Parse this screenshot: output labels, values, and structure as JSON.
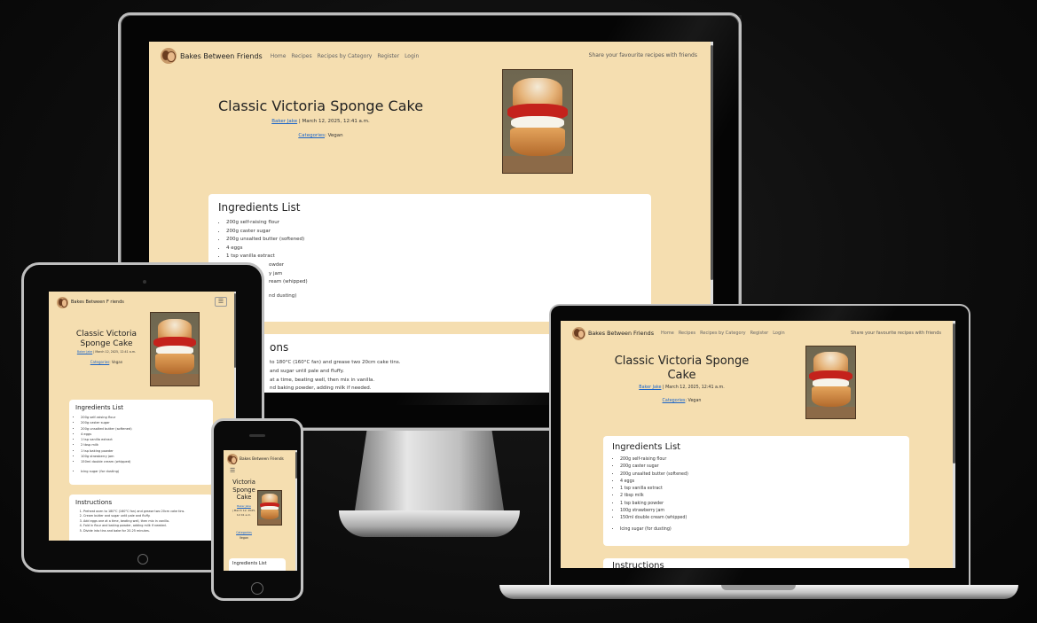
{
  "site": {
    "brand": "Bakes Between Friends",
    "brand_tablet": "Bakes Between F riends",
    "nav": [
      "Home",
      "Recipes",
      "Recipes by Category",
      "Register",
      "Login"
    ],
    "tagline": "Share your favourite recipes with friends",
    "menu_icon": "hamburger-icon"
  },
  "recipe": {
    "title": "Classic Victoria Sponge Cake",
    "title_phone": "Victoria Sponge Cake",
    "author": "Baker Jake",
    "date": " | March 12, 2025, 12:41 a.m.",
    "author_phone": "Baker Jake",
    "date_phone": "| March 12, 2025, 12:41 a.m.",
    "categories_label": "Categories",
    "categories_value": ": Vegan",
    "categories_value_phone": "Vegan"
  },
  "ingredients": {
    "heading": "Ingredients List",
    "items": [
      "200g self-raising flour",
      "200g caster sugar",
      "200g unsalted butter (softened)",
      "4 eggs",
      "1 tsp vanilla extract",
      "2 tbsp milk",
      "1 tsp baking powder",
      "100g strawberry jam",
      "150ml double cream (whipped)"
    ],
    "extra": "Icing sugar (for dusting)",
    "desktop_items": [
      "200g self-raising flour",
      "200g caster sugar",
      "200g unsalted butter (softened)",
      "4 eggs",
      "1 tsp vanilla extract"
    ],
    "desktop_partial": [
      "owder",
      "y jam",
      "ream (whipped)"
    ],
    "desktop_extra": "nd dusting)"
  },
  "instructions": {
    "heading": "Instructions",
    "desktop_heading": "ons",
    "laptop_heading": "Instructions",
    "steps": [
      "Preheat oven to 180°C (160°C fan) and grease two 20cm cake tins.",
      "Cream butter and sugar until pale and fluffy.",
      "Add eggs one at a time, beating well, then mix in vanilla.",
      "Fold in flour and baking powder, adding milk if needed.",
      "Divide into tins and bake for 20-25 minutes."
    ],
    "desktop_steps": [
      "to 180°C (160°C fan) and grease two 20cm cake tins.",
      "and sugar until pale and fluffy.",
      "at a time, beating well, then mix in vanilla.",
      "nd baking powder, adding milk if needed."
    ]
  },
  "colors": {
    "page_bg": "#f5deb0",
    "card_bg": "#ffffff",
    "link": "#1a64c8",
    "device_frame": "#0a0a0a",
    "device_rim": "#c8c8c8"
  }
}
